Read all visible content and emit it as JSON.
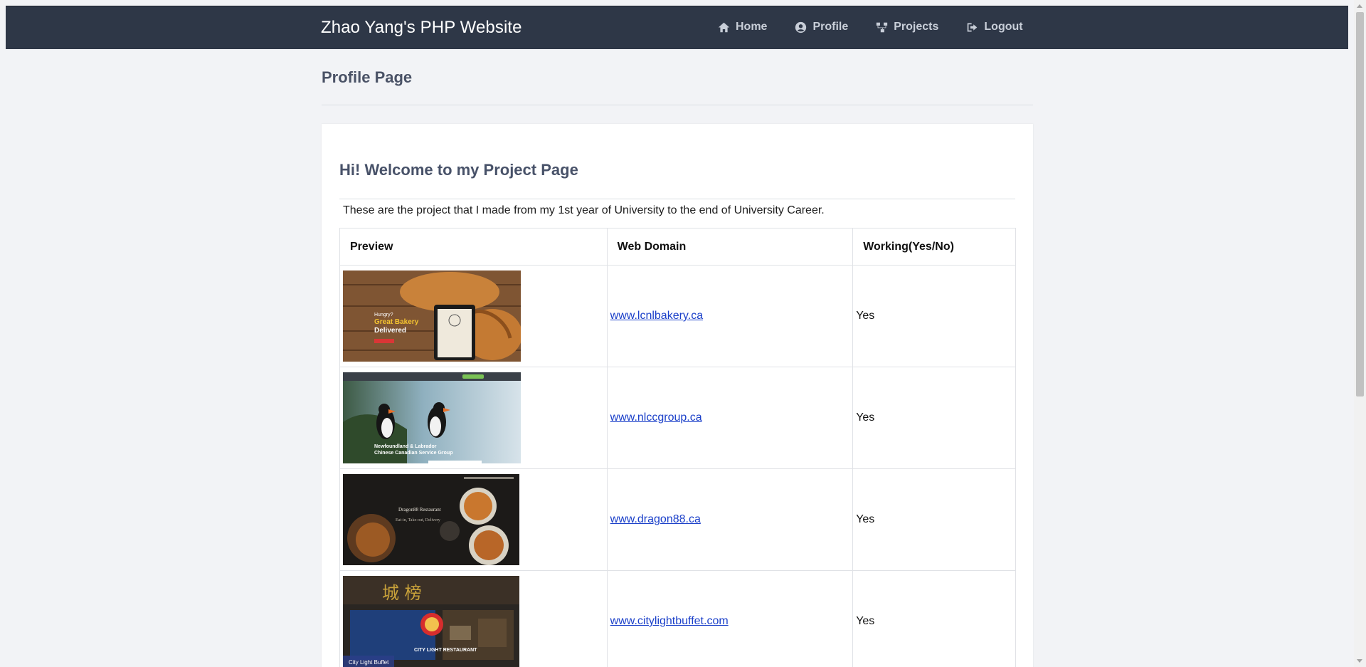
{
  "navbar": {
    "brand": "Zhao Yang's PHP Website",
    "links": [
      {
        "label": "Home",
        "icon": "home-icon"
      },
      {
        "label": "Profile",
        "icon": "user-circle-icon"
      },
      {
        "label": "Projects",
        "icon": "sitemap-icon"
      },
      {
        "label": "Logout",
        "icon": "sign-out-icon"
      }
    ]
  },
  "page": {
    "title": "Profile Page"
  },
  "card": {
    "heading": "Hi! Welcome to my Project Page",
    "description": "These are the project that I made from my 1st year of University to the end of University Career."
  },
  "table": {
    "headers": [
      "Preview",
      "Web Domain",
      "Working(Yes/No)"
    ],
    "rows": [
      {
        "preview": "bakery-site-screenshot",
        "thumb_text_1": "Hungry?",
        "thumb_text_2": "Great Bakery",
        "thumb_text_3": "Delivered",
        "domain": "www.lcnlbakery.ca",
        "working": "Yes"
      },
      {
        "preview": "nlccgroup-site-screenshot",
        "thumb_text_1": "Newfoundland & Labrador",
        "thumb_text_2": "Chinese Canadian Service Group",
        "domain": "www.nlccgroup.ca",
        "working": "Yes"
      },
      {
        "preview": "dragon88-site-screenshot",
        "thumb_text_1": "Dragon88 Restaurant",
        "thumb_text_2": "Eat-in, Take-out, Delivery",
        "domain": "www.dragon88.ca",
        "working": "Yes"
      },
      {
        "preview": "citylight-site-screenshot",
        "thumb_text_1": "城 榜",
        "thumb_text_2": "CITY LIGHT RESTAURANT",
        "thumb_text_3": "City Light Buffet",
        "domain": "www.citylightbuffet.com",
        "working": "Yes"
      }
    ]
  },
  "colors": {
    "navbar_bg": "#2e3747",
    "page_bg": "#f2f3f6",
    "heading": "#485269",
    "link": "#1a3fc9"
  }
}
